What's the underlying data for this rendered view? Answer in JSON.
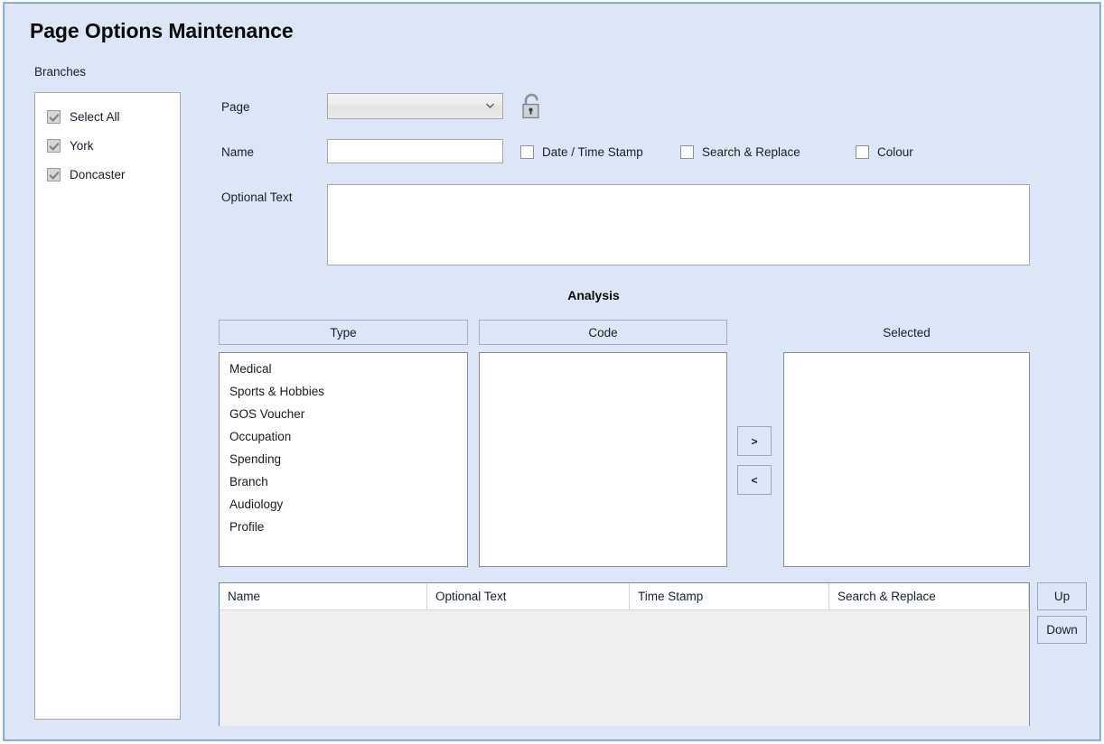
{
  "window": {
    "title": "Page Options Maintenance",
    "accent_border": "#6f9ddb",
    "background": "#dce6f7"
  },
  "branches": {
    "label": "Branches",
    "items": [
      {
        "label": "Select All",
        "checked": true
      },
      {
        "label": "York",
        "checked": true
      },
      {
        "label": "Doncaster",
        "checked": true
      }
    ]
  },
  "form": {
    "page_label": "Page",
    "page_value": "",
    "lock_state": "unlocked",
    "name_label": "Name",
    "name_value": "",
    "optional_text_label": "Optional Text",
    "optional_text_value": "",
    "options": [
      {
        "label": "Date / Time Stamp",
        "checked": false
      },
      {
        "label": "Search & Replace",
        "checked": false
      },
      {
        "label": "Colour",
        "checked": false
      }
    ]
  },
  "analysis": {
    "title": "Analysis",
    "columns": {
      "type_header": "Type",
      "code_header": "Code",
      "selected_header": "Selected"
    },
    "type_items": [
      "Medical",
      "Sports & Hobbies",
      "GOS Voucher",
      "Occupation",
      "Spending",
      "Branch",
      "Audiology",
      "Profile"
    ],
    "code_items": [],
    "selected_items": [],
    "move_right_label": ">",
    "move_left_label": "<"
  },
  "grid": {
    "headers": [
      "Name",
      "Optional Text",
      "Time Stamp",
      "Search & Replace"
    ],
    "rows": []
  },
  "side_buttons": {
    "up_label": "Up",
    "down_label": "Down"
  }
}
